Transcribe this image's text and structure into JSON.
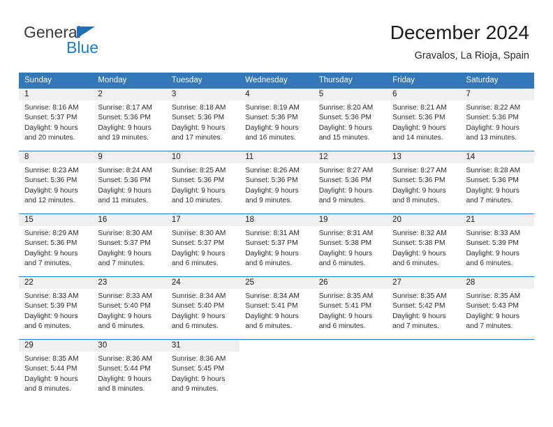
{
  "logo": {
    "word1": "General",
    "word2": "Blue",
    "accent_color": "#1f7fc4"
  },
  "header": {
    "title": "December 2024",
    "subtitle": "Gravalos, La Rioja, Spain"
  },
  "calendar": {
    "header_bg": "#3277b8",
    "weekdays": [
      "Sunday",
      "Monday",
      "Tuesday",
      "Wednesday",
      "Thursday",
      "Friday",
      "Saturday"
    ],
    "weeks": [
      [
        {
          "day": "1",
          "sunrise": "Sunrise: 8:16 AM",
          "sunset": "Sunset: 5:37 PM",
          "daylight1": "Daylight: 9 hours",
          "daylight2": "and 20 minutes."
        },
        {
          "day": "2",
          "sunrise": "Sunrise: 8:17 AM",
          "sunset": "Sunset: 5:36 PM",
          "daylight1": "Daylight: 9 hours",
          "daylight2": "and 19 minutes."
        },
        {
          "day": "3",
          "sunrise": "Sunrise: 8:18 AM",
          "sunset": "Sunset: 5:36 PM",
          "daylight1": "Daylight: 9 hours",
          "daylight2": "and 17 minutes."
        },
        {
          "day": "4",
          "sunrise": "Sunrise: 8:19 AM",
          "sunset": "Sunset: 5:36 PM",
          "daylight1": "Daylight: 9 hours",
          "daylight2": "and 16 minutes."
        },
        {
          "day": "5",
          "sunrise": "Sunrise: 8:20 AM",
          "sunset": "Sunset: 5:36 PM",
          "daylight1": "Daylight: 9 hours",
          "daylight2": "and 15 minutes."
        },
        {
          "day": "6",
          "sunrise": "Sunrise: 8:21 AM",
          "sunset": "Sunset: 5:36 PM",
          "daylight1": "Daylight: 9 hours",
          "daylight2": "and 14 minutes."
        },
        {
          "day": "7",
          "sunrise": "Sunrise: 8:22 AM",
          "sunset": "Sunset: 5:36 PM",
          "daylight1": "Daylight: 9 hours",
          "daylight2": "and 13 minutes."
        }
      ],
      [
        {
          "day": "8",
          "sunrise": "Sunrise: 8:23 AM",
          "sunset": "Sunset: 5:36 PM",
          "daylight1": "Daylight: 9 hours",
          "daylight2": "and 12 minutes."
        },
        {
          "day": "9",
          "sunrise": "Sunrise: 8:24 AM",
          "sunset": "Sunset: 5:36 PM",
          "daylight1": "Daylight: 9 hours",
          "daylight2": "and 11 minutes."
        },
        {
          "day": "10",
          "sunrise": "Sunrise: 8:25 AM",
          "sunset": "Sunset: 5:36 PM",
          "daylight1": "Daylight: 9 hours",
          "daylight2": "and 10 minutes."
        },
        {
          "day": "11",
          "sunrise": "Sunrise: 8:26 AM",
          "sunset": "Sunset: 5:36 PM",
          "daylight1": "Daylight: 9 hours",
          "daylight2": "and 9 minutes."
        },
        {
          "day": "12",
          "sunrise": "Sunrise: 8:27 AM",
          "sunset": "Sunset: 5:36 PM",
          "daylight1": "Daylight: 9 hours",
          "daylight2": "and 9 minutes."
        },
        {
          "day": "13",
          "sunrise": "Sunrise: 8:27 AM",
          "sunset": "Sunset: 5:36 PM",
          "daylight1": "Daylight: 9 hours",
          "daylight2": "and 8 minutes."
        },
        {
          "day": "14",
          "sunrise": "Sunrise: 8:28 AM",
          "sunset": "Sunset: 5:36 PM",
          "daylight1": "Daylight: 9 hours",
          "daylight2": "and 7 minutes."
        }
      ],
      [
        {
          "day": "15",
          "sunrise": "Sunrise: 8:29 AM",
          "sunset": "Sunset: 5:36 PM",
          "daylight1": "Daylight: 9 hours",
          "daylight2": "and 7 minutes."
        },
        {
          "day": "16",
          "sunrise": "Sunrise: 8:30 AM",
          "sunset": "Sunset: 5:37 PM",
          "daylight1": "Daylight: 9 hours",
          "daylight2": "and 7 minutes."
        },
        {
          "day": "17",
          "sunrise": "Sunrise: 8:30 AM",
          "sunset": "Sunset: 5:37 PM",
          "daylight1": "Daylight: 9 hours",
          "daylight2": "and 6 minutes."
        },
        {
          "day": "18",
          "sunrise": "Sunrise: 8:31 AM",
          "sunset": "Sunset: 5:37 PM",
          "daylight1": "Daylight: 9 hours",
          "daylight2": "and 6 minutes."
        },
        {
          "day": "19",
          "sunrise": "Sunrise: 8:31 AM",
          "sunset": "Sunset: 5:38 PM",
          "daylight1": "Daylight: 9 hours",
          "daylight2": "and 6 minutes."
        },
        {
          "day": "20",
          "sunrise": "Sunrise: 8:32 AM",
          "sunset": "Sunset: 5:38 PM",
          "daylight1": "Daylight: 9 hours",
          "daylight2": "and 6 minutes."
        },
        {
          "day": "21",
          "sunrise": "Sunrise: 8:33 AM",
          "sunset": "Sunset: 5:39 PM",
          "daylight1": "Daylight: 9 hours",
          "daylight2": "and 6 minutes."
        }
      ],
      [
        {
          "day": "22",
          "sunrise": "Sunrise: 8:33 AM",
          "sunset": "Sunset: 5:39 PM",
          "daylight1": "Daylight: 9 hours",
          "daylight2": "and 6 minutes."
        },
        {
          "day": "23",
          "sunrise": "Sunrise: 8:33 AM",
          "sunset": "Sunset: 5:40 PM",
          "daylight1": "Daylight: 9 hours",
          "daylight2": "and 6 minutes."
        },
        {
          "day": "24",
          "sunrise": "Sunrise: 8:34 AM",
          "sunset": "Sunset: 5:40 PM",
          "daylight1": "Daylight: 9 hours",
          "daylight2": "and 6 minutes."
        },
        {
          "day": "25",
          "sunrise": "Sunrise: 8:34 AM",
          "sunset": "Sunset: 5:41 PM",
          "daylight1": "Daylight: 9 hours",
          "daylight2": "and 6 minutes."
        },
        {
          "day": "26",
          "sunrise": "Sunrise: 8:35 AM",
          "sunset": "Sunset: 5:41 PM",
          "daylight1": "Daylight: 9 hours",
          "daylight2": "and 6 minutes."
        },
        {
          "day": "27",
          "sunrise": "Sunrise: 8:35 AM",
          "sunset": "Sunset: 5:42 PM",
          "daylight1": "Daylight: 9 hours",
          "daylight2": "and 7 minutes."
        },
        {
          "day": "28",
          "sunrise": "Sunrise: 8:35 AM",
          "sunset": "Sunset: 5:43 PM",
          "daylight1": "Daylight: 9 hours",
          "daylight2": "and 7 minutes."
        }
      ],
      [
        {
          "day": "29",
          "sunrise": "Sunrise: 8:35 AM",
          "sunset": "Sunset: 5:44 PM",
          "daylight1": "Daylight: 9 hours",
          "daylight2": "and 8 minutes."
        },
        {
          "day": "30",
          "sunrise": "Sunrise: 8:36 AM",
          "sunset": "Sunset: 5:44 PM",
          "daylight1": "Daylight: 9 hours",
          "daylight2": "and 8 minutes."
        },
        {
          "day": "31",
          "sunrise": "Sunrise: 8:36 AM",
          "sunset": "Sunset: 5:45 PM",
          "daylight1": "Daylight: 9 hours",
          "daylight2": "and 9 minutes."
        },
        {
          "day": "",
          "sunrise": "",
          "sunset": "",
          "daylight1": "",
          "daylight2": ""
        },
        {
          "day": "",
          "sunrise": "",
          "sunset": "",
          "daylight1": "",
          "daylight2": ""
        },
        {
          "day": "",
          "sunrise": "",
          "sunset": "",
          "daylight1": "",
          "daylight2": ""
        },
        {
          "day": "",
          "sunrise": "",
          "sunset": "",
          "daylight1": "",
          "daylight2": ""
        }
      ]
    ]
  }
}
